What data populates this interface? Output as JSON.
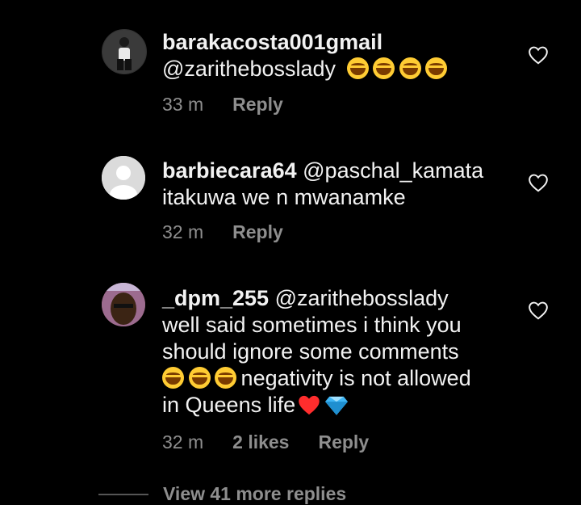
{
  "comments": [
    {
      "username": "barakacosta001gmail",
      "mention": "@zarithebosslady",
      "text": "",
      "emojis": 4,
      "time": "33 m",
      "likes": "",
      "reply_label": "Reply",
      "avatar": "profile-photo"
    },
    {
      "username": "barbiecara64",
      "mention": "@paschal_kamata",
      "text": "itakuwa we n mwanamke",
      "emojis": 0,
      "time": "32 m",
      "likes": "",
      "reply_label": "Reply",
      "avatar": "default-avatar"
    },
    {
      "username": "_dpm_255",
      "mention": "@zarithebosslady",
      "line1": "well said sometimes i think you",
      "line2": "should ignore some comments",
      "line3_after_emojis": " negativity is not allowed",
      "line4": "in Queens life",
      "emojis": 3,
      "time": "32 m",
      "likes": "2 likes",
      "reply_label": "Reply",
      "avatar": "profile-photo"
    }
  ],
  "view_more": "View 41 more replies",
  "colors": {
    "background": "#000000",
    "text": "#f2f2f2",
    "meta": "#8e8e8e",
    "heart": "#ff2d2d",
    "diamond": "#3fb6f5",
    "emoji": "#ffcc33"
  }
}
